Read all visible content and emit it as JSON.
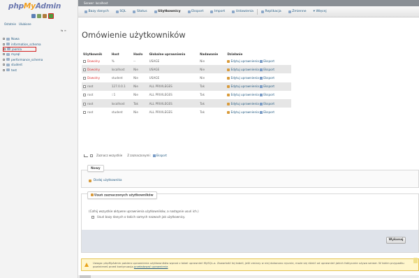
{
  "app": {
    "logo_php": "php",
    "logo_my": "My",
    "logo_admin": "Admin"
  },
  "left": {
    "links": [
      "Ostatnie",
      "Ulubione"
    ],
    "collapse": "⇆ ∞",
    "tree": [
      {
        "label": "Nowa",
        "selected": false
      },
      {
        "label": "information_schema",
        "selected": false
      },
      {
        "label": "joomla",
        "selected": true
      },
      {
        "label": "mysql",
        "selected": false
      },
      {
        "label": "performance_schema",
        "selected": false
      },
      {
        "label": "student",
        "selected": false
      },
      {
        "label": "test",
        "selected": false
      }
    ]
  },
  "topbar": {
    "server": "Serwer: localhost"
  },
  "menu": {
    "tabs": [
      "Bazy danych",
      "SQL",
      "Status",
      "Użytkownicy",
      "Eksport",
      "Import",
      "Ustawienia",
      "Replikacja",
      "Zmienne",
      "Więcej"
    ],
    "active": "Użytkownicy"
  },
  "main": {
    "title": "Omówienie użytkowników",
    "columns": [
      "Użytkownik",
      "Host",
      "Hasło",
      "Globalne uprawnienia",
      "Nadawanie",
      "Działanie"
    ],
    "rows": [
      {
        "user": "Dowolny",
        "host": "%",
        "pass": "--",
        "priv": "USAGE",
        "grant": "Nie",
        "edit": "Edytuj uprawnienia",
        "export": "Eksport"
      },
      {
        "user": "Dowolny",
        "host": "localhost",
        "pass": "Nie",
        "priv": "USAGE",
        "grant": "Nie",
        "edit": "Edytuj uprawnienia",
        "export": "Eksport"
      },
      {
        "user": "Dowolny",
        "host": "student",
        "pass": "Nie",
        "priv": "USAGE",
        "grant": "Nie",
        "edit": "Edytuj uprawnienia",
        "export": "Eksport"
      },
      {
        "user": "root",
        "host": "127.0.0.1",
        "pass": "Nie",
        "priv": "ALL PRIVILEGES",
        "grant": "Tak",
        "edit": "Edytuj uprawnienia",
        "export": "Eksport"
      },
      {
        "user": "root",
        "host": "::1",
        "pass": "Nie",
        "priv": "ALL PRIVILEGES",
        "grant": "Tak",
        "edit": "Edytuj uprawnienia",
        "export": "Eksport"
      },
      {
        "user": "root",
        "host": "localhost",
        "pass": "Tak",
        "priv": "ALL PRIVILEGES",
        "grant": "Tak",
        "edit": "Edytuj uprawnienia",
        "export": "Eksport"
      },
      {
        "user": "root",
        "host": "student",
        "pass": "Nie",
        "priv": "ALL PRIVILEGES",
        "grant": "Tak",
        "edit": "Edytuj uprawnienia",
        "export": "Eksport"
      }
    ],
    "check_all": "Zaznacz wszystkie",
    "with_selected": "Z zaznaczonymi:",
    "export_selected": "Eksport"
  },
  "new_section": {
    "legend": "Nowy",
    "add_user": "Dodaj użytkownika"
  },
  "delete_section": {
    "legend": "Usuń zaznaczonych użytkowników",
    "text": "(Cofnij wszystkie aktywne uprawnienia użytkowników, a następnie usuń ich.)",
    "checkbox": "Usuń bazy danych o takich samych nazwach jak użytkownicy.",
    "go": "Wykonaj"
  },
  "notice": {
    "text": "Uwaga: phpMyAdmin pobiera uprawnienia użytkowników wprost z tabel uprawnień MySQL-a. Zawartość tej tabeli, jeśli zmiany w niej dokonano ręcznie, może się różnić od uprawnień jakich faktycznie używa serwer. W takim przypadku powinieneś przed kontynuacją",
    "link": "przeładować uprawnienia"
  }
}
